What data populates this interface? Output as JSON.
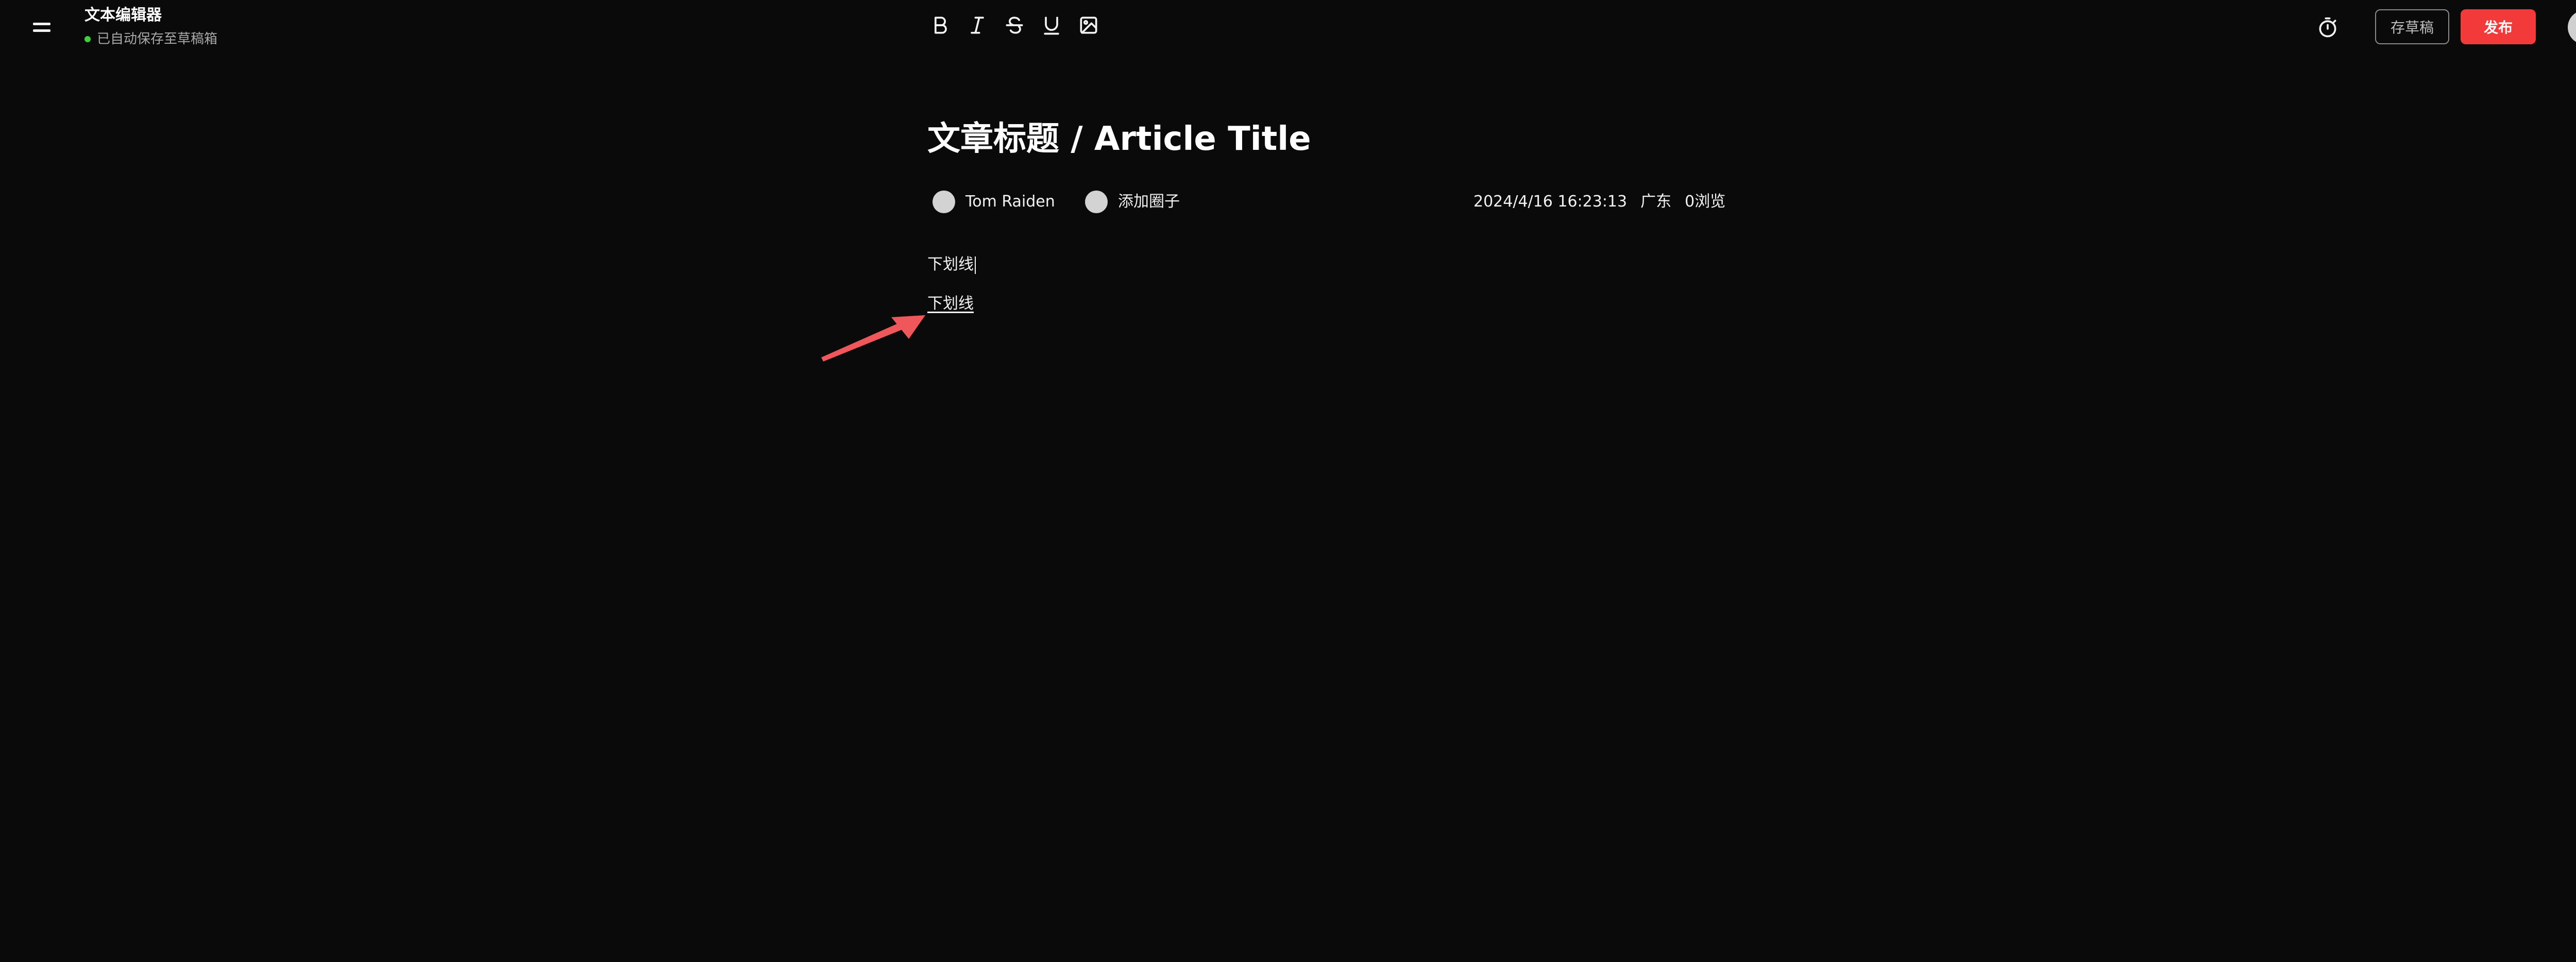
{
  "header": {
    "app_title": "文本编辑器",
    "save_status": "已自动保存至草稿箱",
    "status_color": "#3dd23b",
    "toolbar": [
      {
        "name": "bold",
        "icon": "bold-icon"
      },
      {
        "name": "italic",
        "icon": "italic-icon"
      },
      {
        "name": "strikethrough",
        "icon": "strikethrough-icon"
      },
      {
        "name": "underline",
        "icon": "underline-icon"
      },
      {
        "name": "image",
        "icon": "image-icon"
      }
    ],
    "timer_icon": "timer-icon",
    "draft_label": "存草稿",
    "publish_label": "发布",
    "publish_color": "#f23a3a"
  },
  "article": {
    "title": "文章标题 / Article Title",
    "author": "Tom Raiden",
    "add_circle": "添加圈子",
    "datetime": "2024/4/16 16:23:13",
    "location": "广东",
    "views": "0浏览",
    "lines": [
      {
        "text": "下划线",
        "underlined": false
      },
      {
        "text": "下划线",
        "underlined": true
      }
    ]
  },
  "annotation": {
    "arrow_color": "#f0575b"
  }
}
